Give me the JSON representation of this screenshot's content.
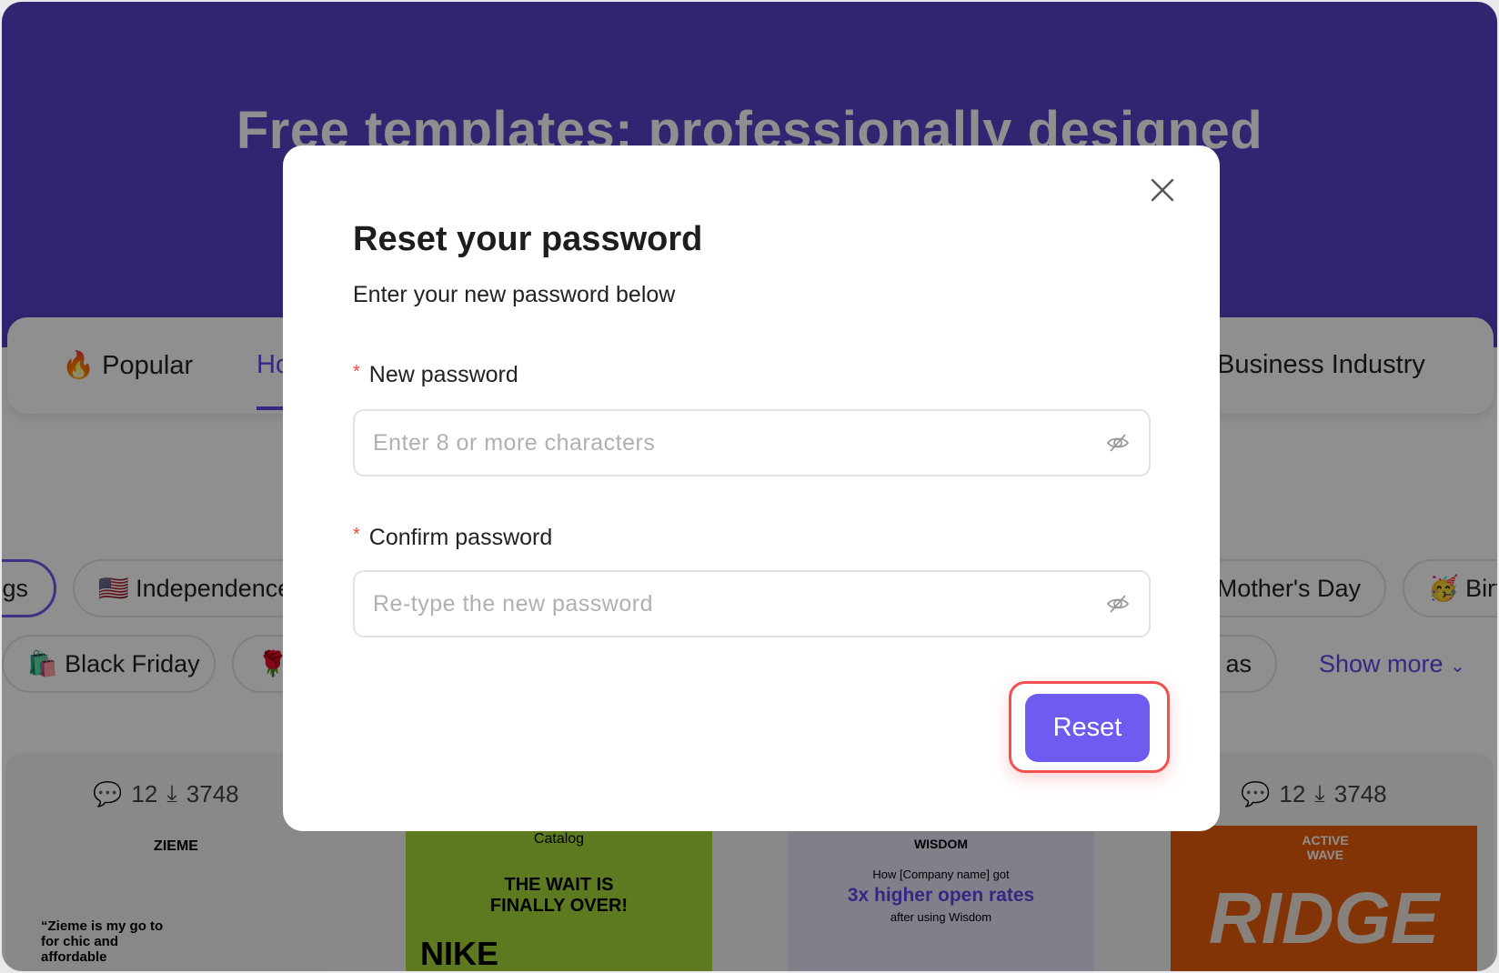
{
  "background": {
    "hero_title": "Free templates: professionally designed",
    "tabs": [
      {
        "label": "Popular",
        "icon": "fire-icon"
      },
      {
        "label": "Ho",
        "active": true
      },
      {
        "label": "Business Industry"
      }
    ],
    "chips_row1": [
      {
        "label": "gs",
        "selected": true
      },
      {
        "label": "Independence",
        "icon": "us-flag-icon"
      },
      {
        "label": "Mother's Day"
      },
      {
        "label": "Birt",
        "icon": "party-face-icon"
      }
    ],
    "chips_row2": [
      {
        "label": "Black Friday",
        "icon": "shopping-bag-icon"
      },
      {
        "label": "",
        "icon": "rose-icon"
      },
      {
        "label": "as"
      }
    ],
    "show_more": "Show more",
    "card_stats": [
      {
        "comments": "12",
        "downloads": "3748"
      },
      {
        "comments": "12",
        "downloads": "3748"
      }
    ],
    "templates": [
      {
        "brand": "ZIEME",
        "quote": "“Zieme is my go to for chic and affordable",
        "bg": "#f2f2f2"
      },
      {
        "brand": "Catalog",
        "headline": "THE WAIT IS FINALLY OVER!",
        "extra": "NIKE",
        "bg": "#a6d93c"
      },
      {
        "brand": "WISDOM",
        "line1": "How [Company name] got",
        "line2": "3x higher open rates",
        "line3": "after using Wisdom",
        "bg": "#e6e4f7"
      },
      {
        "brand": "ACTIVE WAVE",
        "headline": "RIDGE",
        "bg": "#e85d0c"
      }
    ]
  },
  "modal": {
    "title": "Reset your password",
    "subtitle": "Enter your new password below",
    "new_password": {
      "label": "New password",
      "required_mark": "*",
      "placeholder": "Enter 8 or more characters",
      "value": ""
    },
    "confirm_password": {
      "label": "Confirm password",
      "required_mark": "*",
      "placeholder": "Re-type the new password",
      "value": ""
    },
    "reset_label": "Reset"
  },
  "colors": {
    "accent": "#6e5bef",
    "highlight": "#f24f4f",
    "required": "#f04b3a"
  }
}
